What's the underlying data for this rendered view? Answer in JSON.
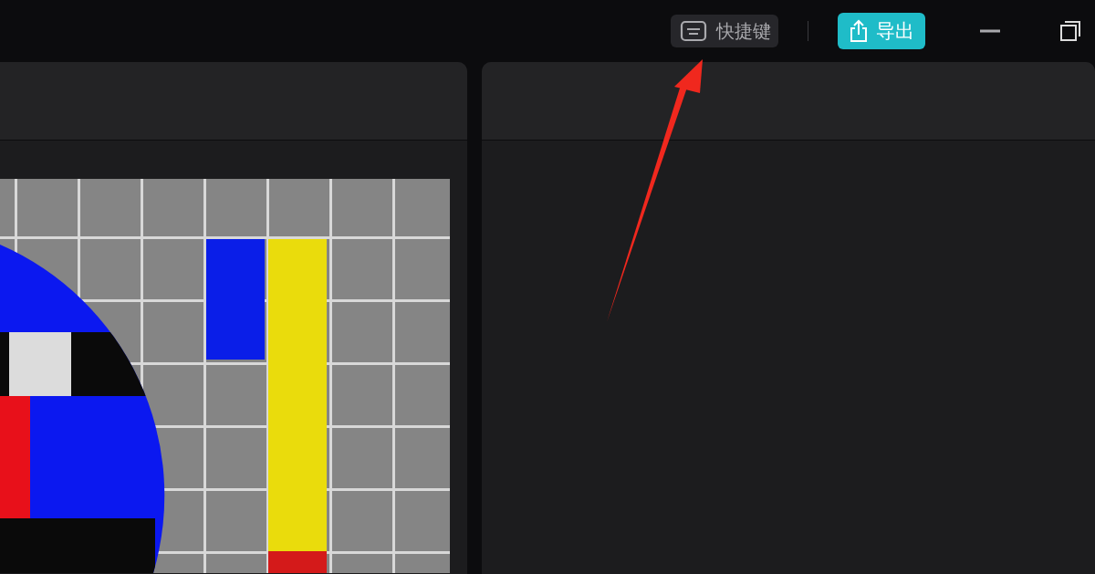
{
  "title_bar": {
    "shortcuts_button": {
      "label": "快捷键"
    },
    "export_button": {
      "label": "导出"
    }
  }
}
